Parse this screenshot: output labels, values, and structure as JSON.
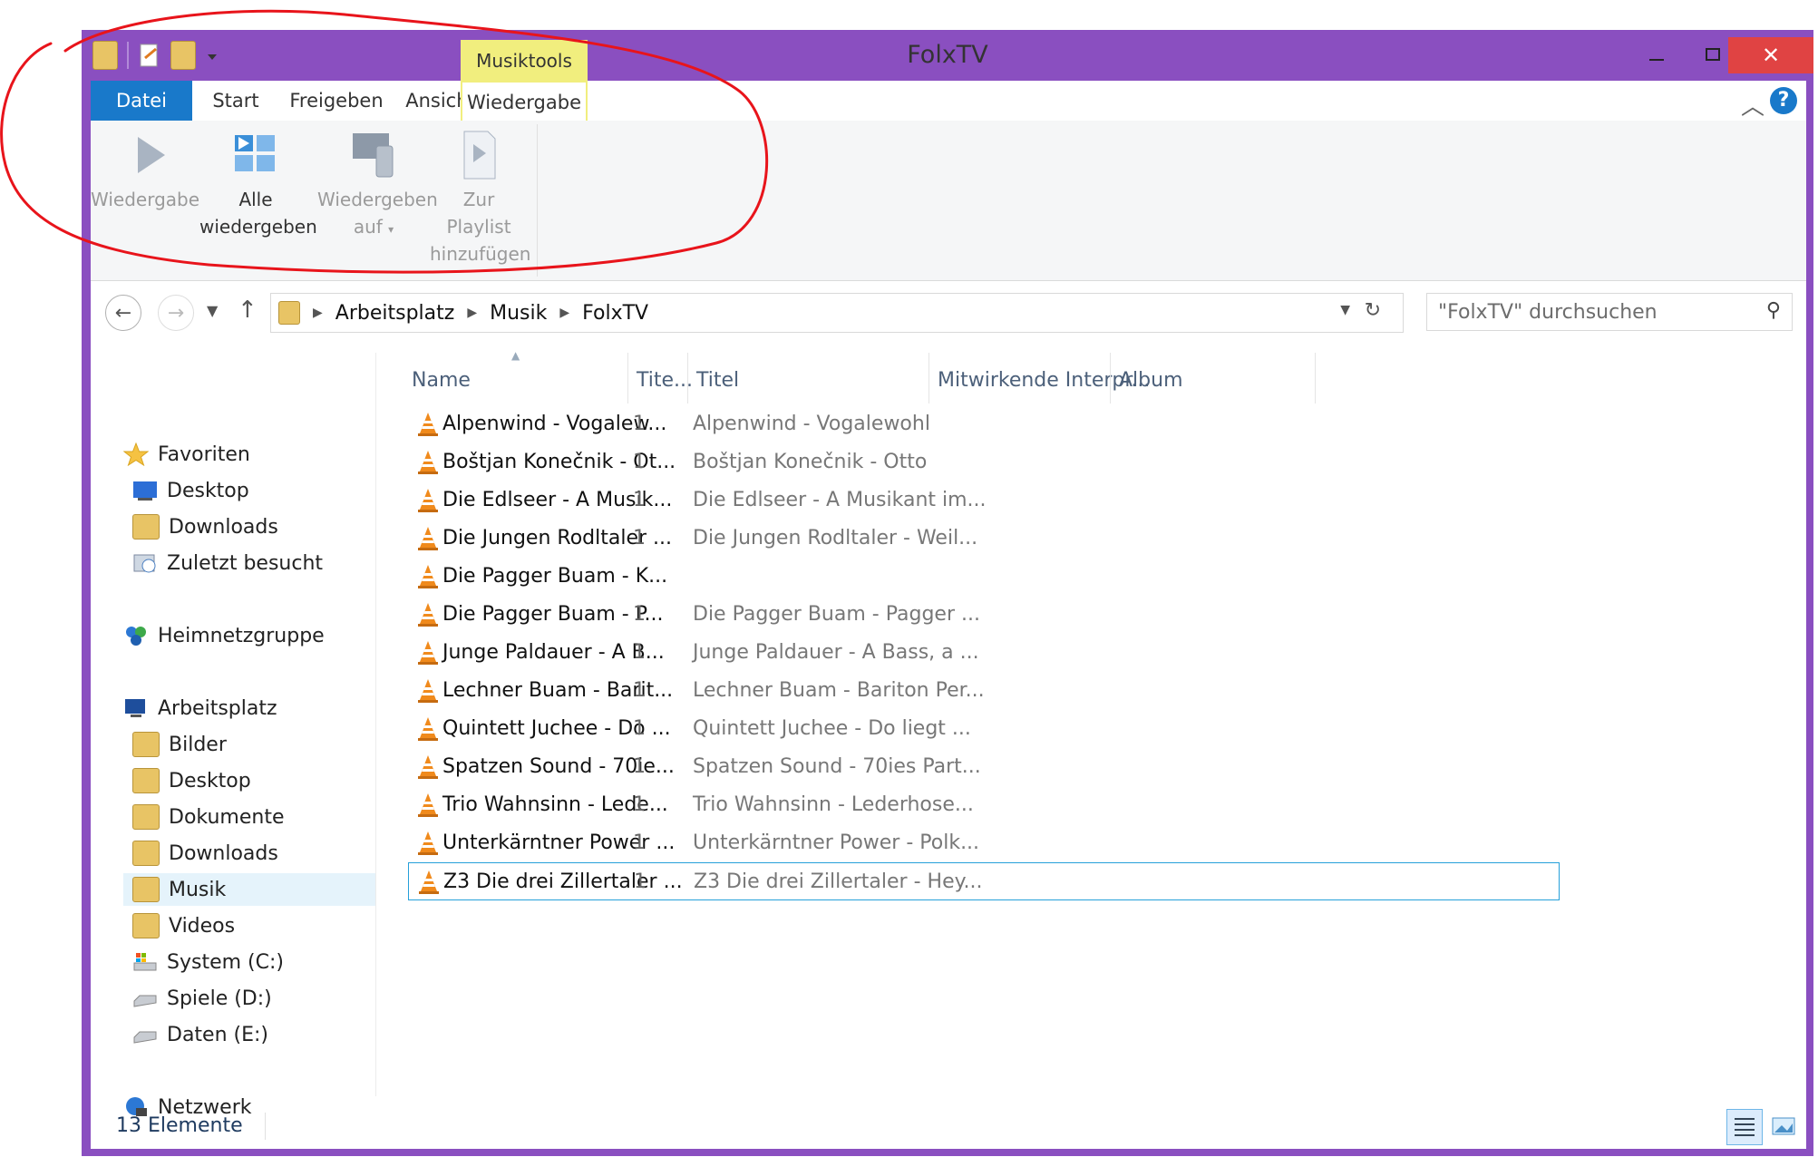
{
  "window": {
    "title": "FolxTV",
    "context_tab": "Musiktools"
  },
  "ribbon_tabs": [
    "Datei",
    "Start",
    "Freigeben",
    "Ansicht",
    "Wiedergabe"
  ],
  "ribbon_buttons": [
    {
      "label1": "Wiedergabe",
      "label2": "",
      "enabled": false,
      "icon": "play-icon"
    },
    {
      "label1": "Alle",
      "label2": "wiedergeben",
      "enabled": true,
      "icon": "play-all-icon"
    },
    {
      "label1": "Wiedergeben",
      "label2": "auf",
      "enabled": false,
      "icon": "play-to-device-icon"
    },
    {
      "label1": "Zur Playlist",
      "label2": "hinzufügen",
      "enabled": false,
      "icon": "add-to-playlist-icon"
    }
  ],
  "address": {
    "crumbs": [
      "Arbeitsplatz",
      "Musik",
      "FolxTV"
    ]
  },
  "search": {
    "placeholder": "\"FolxTV\" durchsuchen"
  },
  "sidebar": {
    "favorites": [
      "Favoriten",
      "Desktop",
      "Downloads",
      "Zuletzt besucht"
    ],
    "homegroup": "Heimnetzgruppe",
    "computer": [
      "Arbeitsplatz",
      "Bilder",
      "Desktop",
      "Dokumente",
      "Downloads",
      "Musik",
      "Videos",
      "System (C:)",
      "Spiele (D:)",
      "Daten (E:)"
    ],
    "network": "Netzwerk",
    "selected": "Musik"
  },
  "columns": [
    "Name",
    "Tite...",
    "Titel",
    "Mitwirkende Interpr...",
    "Album"
  ],
  "files": [
    {
      "name": "Alpenwind - Vogalew...",
      "nr": "1",
      "title": "Alpenwind - Vogalewohl"
    },
    {
      "name": "Boštjan Konečnik - Ot...",
      "nr": "1",
      "title": "Boštjan Konečnik - Otto"
    },
    {
      "name": "Die Edlseer - A Musik...",
      "nr": "1",
      "title": "Die Edlseer - A Musikant im..."
    },
    {
      "name": "Die Jungen Rodltaler ...",
      "nr": "1",
      "title": "Die Jungen Rodltaler - Weil..."
    },
    {
      "name": "Die Pagger Buam - K...",
      "nr": "",
      "title": ""
    },
    {
      "name": "Die Pagger Buam - P...",
      "nr": "1",
      "title": "Die Pagger Buam - Pagger ..."
    },
    {
      "name": "Junge Paldauer - A B...",
      "nr": "1",
      "title": "Junge Paldauer - A Bass, a ..."
    },
    {
      "name": "Lechner Buam - Barit...",
      "nr": "1",
      "title": "Lechner Buam - Bariton Per..."
    },
    {
      "name": "Quintett Juchee - Do ...",
      "nr": "1",
      "title": "Quintett Juchee - Do liegt ..."
    },
    {
      "name": "Spatzen Sound - 70ie...",
      "nr": "1",
      "title": "Spatzen Sound - 70ies Part..."
    },
    {
      "name": "Trio Wahnsinn - Lede...",
      "nr": "1",
      "title": "Trio Wahnsinn - Lederhose..."
    },
    {
      "name": "Unterkärntner Power ...",
      "nr": "1",
      "title": "Unterkärntner Power - Polk..."
    },
    {
      "name": "Z3 Die drei Zillertaler ...",
      "nr": "1",
      "title": "Z3 Die drei Zillertaler - Hey..."
    }
  ],
  "selected_file": 12,
  "status": "13 Elemente",
  "colors": {
    "frame": "#8a4fc0",
    "datei": "#1979ca",
    "context": "#f1ee7e",
    "annotation": "#e8141b"
  }
}
